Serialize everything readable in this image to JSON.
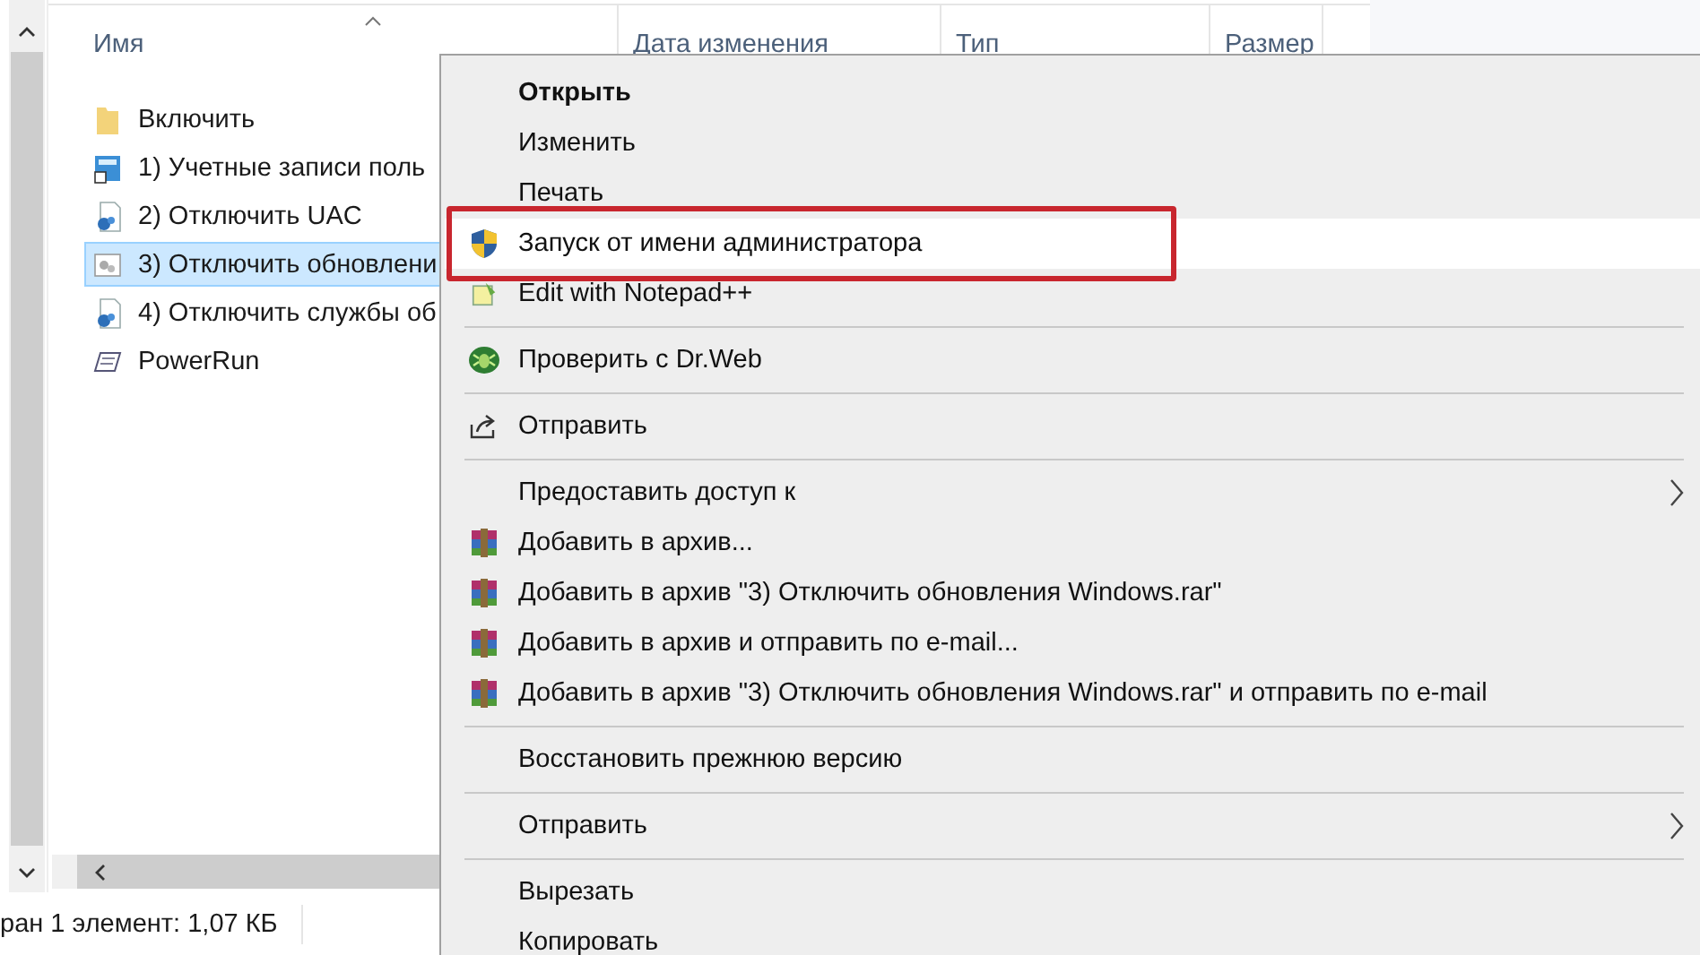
{
  "explorer": {
    "columns": [
      {
        "label": "Имя",
        "sorted": true
      },
      {
        "label": "Дата изменения",
        "sorted": false
      },
      {
        "label": "Тип",
        "sorted": false
      },
      {
        "label": "Размер",
        "sorted": false
      }
    ],
    "files": [
      {
        "name": "Включить",
        "kind": "folder",
        "selected": false
      },
      {
        "name": "1) Учетные записи поль",
        "kind": "shortcut",
        "selected": false
      },
      {
        "name": "2) Отключить UAC",
        "kind": "script",
        "selected": false
      },
      {
        "name": "3) Отключить обновлени",
        "kind": "settings",
        "selected": true
      },
      {
        "name": "4) Отключить службы об",
        "kind": "script",
        "selected": false
      },
      {
        "name": "PowerRun",
        "kind": "app",
        "selected": false
      }
    ],
    "status": "ран 1 элемент: 1,07 КБ"
  },
  "context_menu": {
    "items": [
      {
        "kind": "plain",
        "label": "Открыть",
        "bold": true,
        "submenu": false,
        "highlighted": false
      },
      {
        "kind": "plain",
        "label": "Изменить",
        "bold": false,
        "submenu": false,
        "highlighted": false
      },
      {
        "kind": "plain",
        "label": "Печать",
        "bold": false,
        "submenu": false,
        "highlighted": false
      },
      {
        "kind": "shield",
        "label": "Запуск от имени администратора",
        "bold": false,
        "submenu": false,
        "highlighted": true
      },
      {
        "kind": "notepad",
        "label": "Edit with Notepad++",
        "bold": false,
        "submenu": false,
        "highlighted": false
      },
      {
        "kind": "separator"
      },
      {
        "kind": "spider",
        "label": "Проверить с Dr.Web",
        "bold": false,
        "submenu": false,
        "highlighted": false
      },
      {
        "kind": "separator"
      },
      {
        "kind": "share",
        "label": "Отправить",
        "bold": false,
        "submenu": false,
        "highlighted": false
      },
      {
        "kind": "separator"
      },
      {
        "kind": "plain",
        "label": "Предоставить доступ к",
        "bold": false,
        "submenu": true,
        "highlighted": false
      },
      {
        "kind": "archive",
        "label": "Добавить в архив...",
        "bold": false,
        "submenu": false,
        "highlighted": false
      },
      {
        "kind": "archive",
        "label": "Добавить в архив \"3) Отключить обновления Windows.rar\"",
        "bold": false,
        "submenu": false,
        "highlighted": false
      },
      {
        "kind": "archive",
        "label": "Добавить в архив и отправить по e-mail...",
        "bold": false,
        "submenu": false,
        "highlighted": false
      },
      {
        "kind": "archive",
        "label": "Добавить в архив \"3) Отключить обновления Windows.rar\" и отправить по e-mail",
        "bold": false,
        "submenu": false,
        "highlighted": false
      },
      {
        "kind": "separator"
      },
      {
        "kind": "plain",
        "label": "Восстановить прежнюю версию",
        "bold": false,
        "submenu": false,
        "highlighted": false
      },
      {
        "kind": "separator"
      },
      {
        "kind": "plain",
        "label": "Отправить",
        "bold": false,
        "submenu": true,
        "highlighted": false
      },
      {
        "kind": "separator"
      },
      {
        "kind": "plain",
        "label": "Вырезать",
        "bold": false,
        "submenu": false,
        "highlighted": false
      },
      {
        "kind": "plain",
        "label": "Копировать",
        "bold": false,
        "submenu": false,
        "highlighted": false
      }
    ]
  }
}
